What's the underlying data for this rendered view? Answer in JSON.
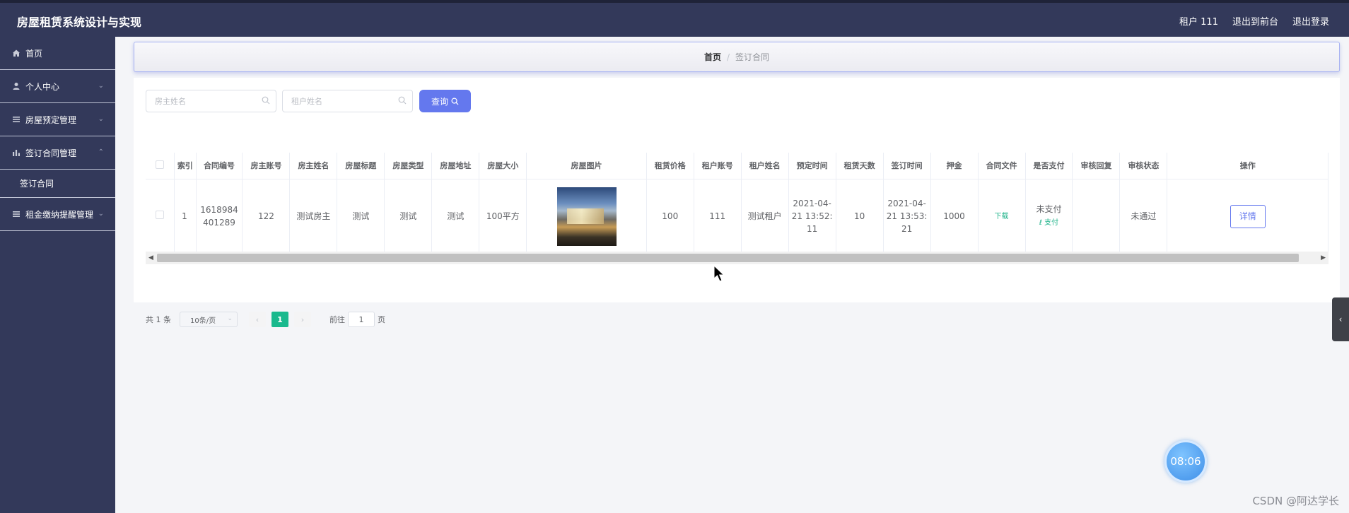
{
  "app": {
    "title": "房屋租赁系统设计与实现",
    "user_label": "租户 111",
    "to_front_label": "退出到前台",
    "logout_label": "退出登录"
  },
  "sidebar": {
    "items": [
      {
        "label": "首页",
        "icon": "home-icon"
      },
      {
        "label": "个人中心",
        "icon": "user-icon"
      },
      {
        "label": "房屋预定管理",
        "icon": "list-icon"
      },
      {
        "label": "签订合同管理",
        "icon": "bar-chart-icon",
        "expanded": true
      },
      {
        "label": "租金缴纳提醒管理",
        "icon": "list-icon"
      }
    ],
    "submenu": {
      "label": "签订合同"
    }
  },
  "breadcrumb": {
    "home": "首页",
    "separator": "/",
    "current": "签订合同"
  },
  "search": {
    "landlord_placeholder": "房主姓名",
    "tenant_placeholder": "租户姓名",
    "query_label": "查询"
  },
  "table": {
    "headers": [
      "索引",
      "合同编号",
      "房主账号",
      "房主姓名",
      "房屋标题",
      "房屋类型",
      "房屋地址",
      "房屋大小",
      "房屋图片",
      "租赁价格",
      "租户账号",
      "租户姓名",
      "预定时间",
      "租赁天数",
      "签订时间",
      "押金",
      "合同文件",
      "是否支付",
      "审核回复",
      "审核状态",
      "操作"
    ],
    "rows": [
      {
        "index": "1",
        "contract_no": "1618984401289",
        "landlord_account": "122",
        "landlord_name": "测试房主",
        "house_title": "测试",
        "house_type": "测试",
        "house_address": "测试",
        "house_size": "100平方",
        "price": "100",
        "tenant_account": "111",
        "tenant_name": "测试租户",
        "reserve_time": "2021-04-21 13:52:11",
        "days": "10",
        "sign_time": "2021-04-21 13:53:21",
        "deposit": "1000",
        "file_link": "下载",
        "paid_status": "未支付",
        "pay_link": "支付",
        "review_reply": "",
        "review_status": "未通过",
        "detail_label": "详情"
      }
    ]
  },
  "pagination": {
    "total_label": "共 1 条",
    "page_size_label": "10条/页",
    "current_page": "1",
    "goto_label": "前往",
    "goto_value": "1",
    "page_unit": "页"
  },
  "timer": {
    "value": "08:06"
  },
  "watermark": "CSDN @阿达学长",
  "colors": {
    "sidebar_bg": "#33395a",
    "primary": "#6478ee",
    "success": "#19b98d"
  }
}
